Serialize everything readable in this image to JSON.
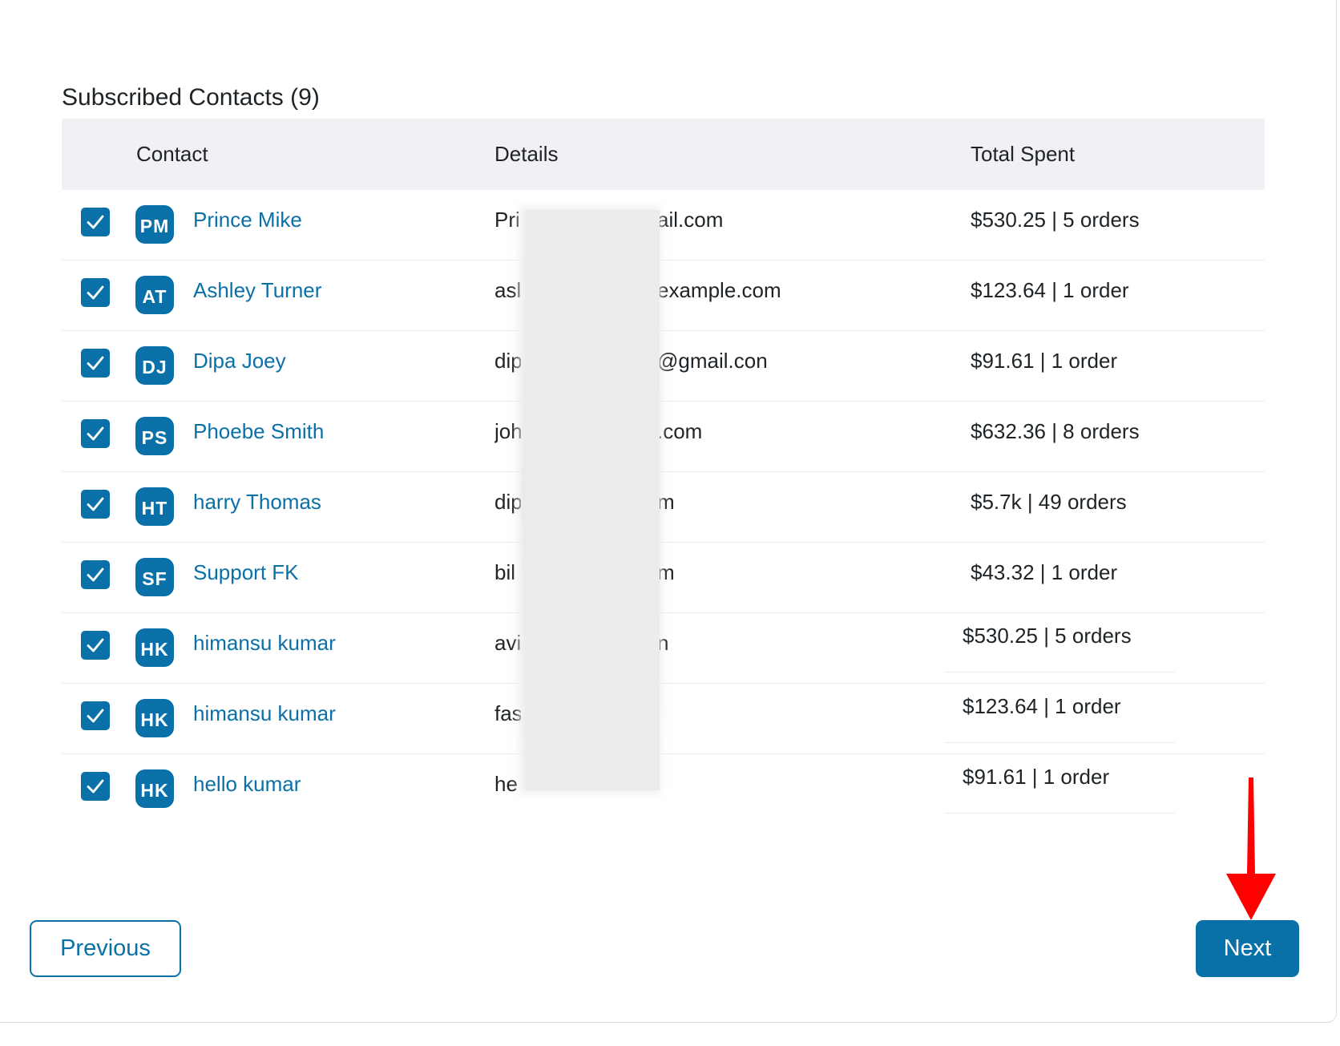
{
  "section": {
    "title": "Subscribed Contacts (9)"
  },
  "table": {
    "headers": {
      "contact": "Contact",
      "details": "Details",
      "total_spent": "Total Spent"
    },
    "rows": [
      {
        "checked": true,
        "initials": "PM",
        "name": "Prince Mike",
        "email_start": "Pri",
        "email_end": "ail.com",
        "spent": "$530.25 | 5 orders"
      },
      {
        "checked": true,
        "initials": "AT",
        "name": "Ashley Turner",
        "email_start": "asl",
        "email_end": "example.com",
        "spent": "$123.64 | 1 order"
      },
      {
        "checked": true,
        "initials": "DJ",
        "name": "Dipa Joey",
        "email_start": "dip",
        "email_end": "@gmail.con",
        "spent": "$91.61 | 1 order"
      },
      {
        "checked": true,
        "initials": "PS",
        "name": "Phoebe Smith",
        "email_start": "joh",
        "email_end": ".com",
        "spent": "$632.36 | 8 orders"
      },
      {
        "checked": true,
        "initials": "HT",
        "name": "harry Thomas",
        "email_start": "dip",
        "email_end": "m",
        "spent": "$5.7k | 49 orders"
      },
      {
        "checked": true,
        "initials": "SF",
        "name": "Support FK",
        "email_start": "bil",
        "email_end": "m",
        "spent": "$43.32 | 1 order"
      },
      {
        "checked": true,
        "initials": "HK",
        "name": "himansu kumar",
        "email_start": "avi",
        "email_end": "n",
        "spent": "$530.25 | 5 orders"
      },
      {
        "checked": true,
        "initials": "HK",
        "name": "himansu kumar",
        "email_start": "fas",
        "email_end": "",
        "spent": "$123.64 | 1 order"
      },
      {
        "checked": true,
        "initials": "HK",
        "name": "hello kumar",
        "email_start": "he",
        "email_end": "",
        "spent": "$91.61 | 1 order"
      }
    ]
  },
  "buttons": {
    "previous": "Previous",
    "next": "Next"
  },
  "colors": {
    "accent": "#0a70a8",
    "header_bg": "#f0f0f5",
    "annotation_arrow": "#ff0000"
  },
  "icons": {
    "checkbox": "checkmark-icon",
    "annotation": "red-down-arrow-icon"
  }
}
